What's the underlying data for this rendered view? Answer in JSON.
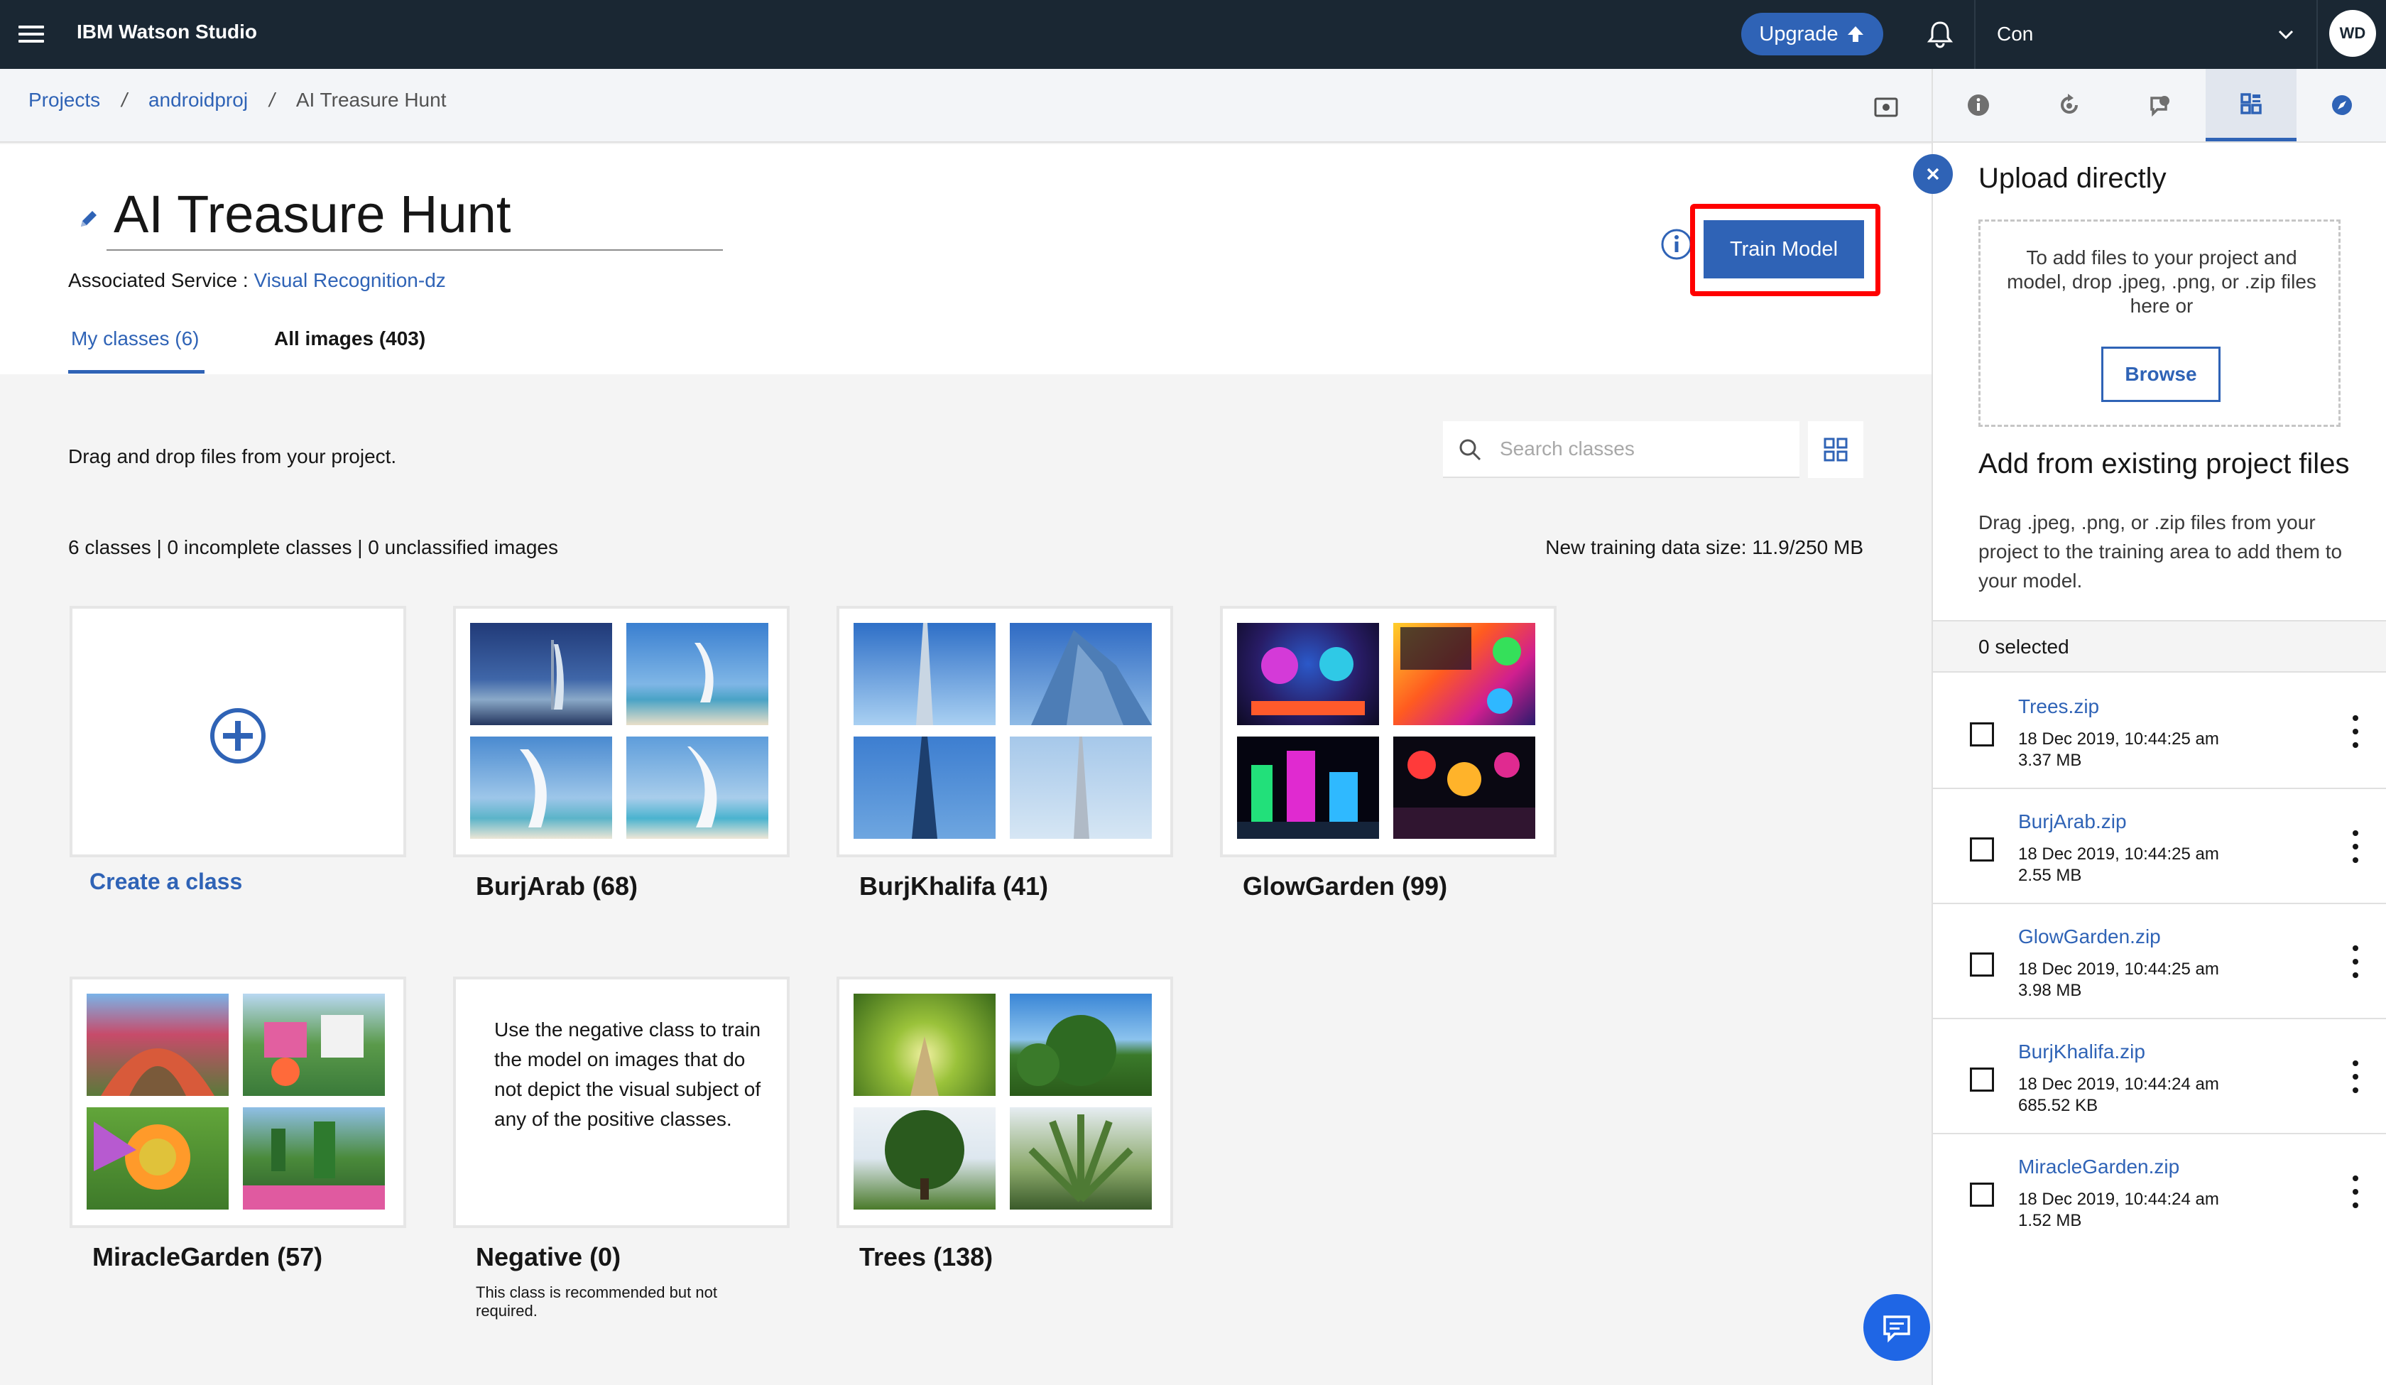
{
  "app": {
    "brand": "IBM Watson Studio",
    "upgrade_label": "Upgrade",
    "account_label": "Con",
    "avatar_initials": "WD"
  },
  "breadcrumb": {
    "items": [
      "Projects",
      "androidproj",
      "AI Treasure Hunt"
    ],
    "separator": "/"
  },
  "header": {
    "title": "AI Treasure Hunt",
    "associated_label": "Associated Service : ",
    "associated_service": "Visual Recognition-dz",
    "train_button": "Train Model",
    "tabs": [
      {
        "label": "My classes (6)",
        "active": true
      },
      {
        "label": "All images (403)",
        "active": false
      }
    ]
  },
  "content": {
    "drag_text": "Drag and drop files from your project.",
    "search_placeholder": "Search classes",
    "stats": "6 classes | 0 incomplete classes | 0 unclassified images",
    "training_size": "New training data size: 11.9/250 MB",
    "create_label": "Create a class",
    "classes": [
      {
        "name": "BurjArab (68)"
      },
      {
        "name": "BurjKhalifa (41)"
      },
      {
        "name": "GlowGarden (99)"
      },
      {
        "name": "MiracleGarden (57)"
      },
      {
        "name": "Trees (138)"
      }
    ],
    "negative": {
      "name": "Negative (0)",
      "description": "Use the negative class to train the model on images that do not depict the visual subject of any of the positive classes.",
      "note": "This class is recommended but not required."
    }
  },
  "panel": {
    "upload_title": "Upload directly",
    "drop_text": "To add files to your project and model, drop .jpeg, .png, or .zip files here or",
    "browse_label": "Browse",
    "add_title": "Add from existing project files",
    "add_desc": "Drag .jpeg, .png, or .zip files from your project to the training area to add them to your model.",
    "selected": "0 selected",
    "files": [
      {
        "name": "Trees.zip",
        "date": "18 Dec 2019, 10:44:25 am",
        "size": "3.37 MB"
      },
      {
        "name": "BurjArab.zip",
        "date": "18 Dec 2019, 10:44:25 am",
        "size": "2.55 MB"
      },
      {
        "name": "GlowGarden.zip",
        "date": "18 Dec 2019, 10:44:25 am",
        "size": "3.98 MB"
      },
      {
        "name": "BurjKhalifa.zip",
        "date": "18 Dec 2019, 10:44:24 am",
        "size": "685.52 KB"
      },
      {
        "name": "MiracleGarden.zip",
        "date": "18 Dec 2019, 10:44:24 am",
        "size": "1.52 MB"
      }
    ]
  },
  "colors": {
    "topbar": "#1a2733",
    "accent": "#2f63b6",
    "highlight": "#ff0000"
  }
}
